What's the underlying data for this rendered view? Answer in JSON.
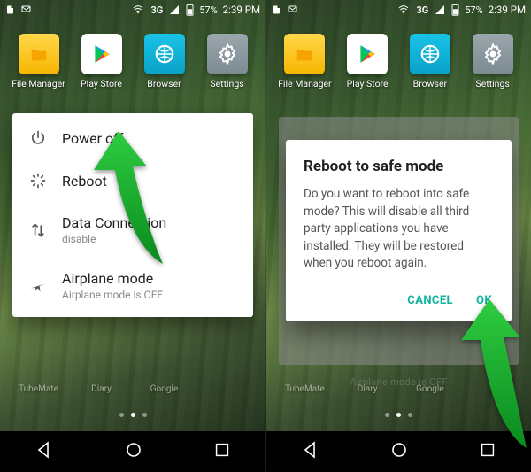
{
  "accent": "#11b3a0",
  "status": {
    "network_label": "3G",
    "battery_pct": "57%",
    "time": "2:39 PM"
  },
  "apps": [
    {
      "label": "File Manager"
    },
    {
      "label": "Play Store"
    },
    {
      "label": "Browser"
    },
    {
      "label": "Settings"
    }
  ],
  "ghost_labels": [
    "TubeMate",
    "Diary",
    "Google"
  ],
  "power_menu": {
    "items": [
      {
        "icon": "power-icon",
        "title": "Power off",
        "sub": ""
      },
      {
        "icon": "reboot-icon",
        "title": "Reboot",
        "sub": ""
      },
      {
        "icon": "data-icon",
        "title": "Data Connection",
        "sub": "disable"
      },
      {
        "icon": "airplane-icon",
        "title": "Airplane mode",
        "sub": "Airplane mode is OFF"
      }
    ]
  },
  "dialog": {
    "title": "Reboot to safe mode",
    "body": "Do you want to reboot into safe mode? This will disable all third party applications you have installed. They will be restored when you reboot again.",
    "cancel": "CANCEL",
    "ok": "OK"
  },
  "right_ghost_line": "Airplane mode is OFF"
}
